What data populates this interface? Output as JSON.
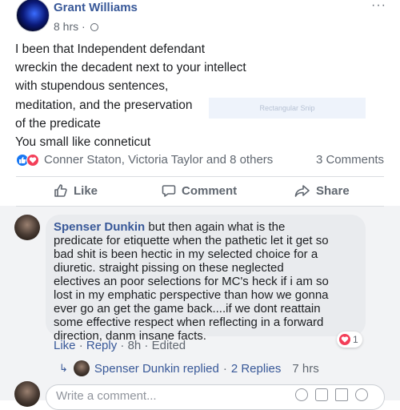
{
  "post": {
    "author": "Grant Williams",
    "time": "8 hrs ·",
    "more": "···",
    "body_lines": [
      "I been that Independent defendant",
      "wreckin the decadent next to your intellect",
      "with stupendous sentences,",
      "meditation, and the preservation",
      "of the predicate",
      "You small like conneticut"
    ],
    "overlay_text": "Rectangular Snip"
  },
  "reactions": {
    "names": "Conner Staton, Victoria Taylor and 8 others",
    "comments": "3 Comments",
    "icons": [
      "like-icon",
      "love-icon"
    ]
  },
  "actions": {
    "like": "Like",
    "comment": "Comment",
    "share": "Share"
  },
  "comment": {
    "author": "Spenser Dunkin",
    "lines": [
      " but then again what is the",
      "predicate for etiquette when the pathetic let it get so",
      "bad shit is been hectic in my selected choice for a",
      "diuretic. straight pissing on these neglected",
      "electives an poor selections for MC's heck if i am so",
      "lost in my emphatic perspective than how we gonna",
      "ever go an get the game back....if we dont reattain",
      "some effective respect when reflecting in a forward",
      "direction, danm insane facts."
    ],
    "reaction_count": "1",
    "meta": {
      "like": "Like",
      "dot1": " · ",
      "reply": "Reply",
      "dot2": " · ",
      "time": "8h",
      "dot3": " · ",
      "edited": "Edited"
    },
    "replies": {
      "author_replied": "Spenser Dunkin replied",
      "sep": "·",
      "count": "2 Replies",
      "time": "7 hrs"
    }
  },
  "input": {
    "placeholder": "Write a comment..."
  },
  "colors": {
    "link": "#385898",
    "secondary": "#606770",
    "like_blue": "#1877f2",
    "love_red": "#f33e58"
  }
}
